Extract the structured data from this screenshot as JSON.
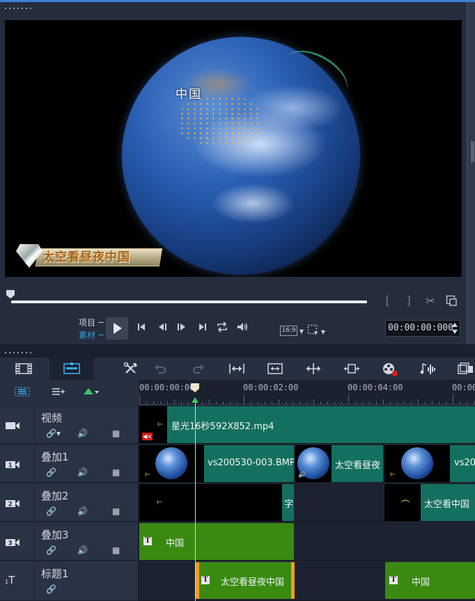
{
  "preview": {
    "overlay_text": "中国",
    "logo_text": "太空看昼夜中国"
  },
  "player": {
    "mode_project": "项目",
    "mode_clip": "素材",
    "aspect_ratio": "16:9",
    "timecode": "00:00:00:000",
    "mark_in": "[",
    "mark_out": "]"
  },
  "colors": {
    "accent": "#3b82d6",
    "video_clip": "#14705e",
    "title_clip": "#3a8a12",
    "selection": "#f39c22",
    "clip_active_text": "#2ba0e8"
  },
  "toolbar_icons": [
    "storyboard-view-icon",
    "timeline-view-icon",
    "tools-icon",
    "undo-icon",
    "redo-icon",
    "fit-to-window-icon",
    "zoom-to-fit-icon",
    "expand-icon",
    "track-height-icon",
    "record-capture-icon",
    "audio-mixer-icon",
    "multi-camera-icon"
  ],
  "timeline": {
    "ruler_labels": [
      "00:00:00:00",
      "00:00:02:00",
      "00:00:04:00",
      "00:00"
    ],
    "tracks": [
      {
        "id": "video",
        "icon_label": "",
        "name": "视频",
        "clips": [
          {
            "label": "星光16秒592X852.mp4"
          }
        ]
      },
      {
        "id": "overlay1",
        "icon_label": "1",
        "name": "叠加1",
        "clips": [
          {
            "label": "vs200530-003.BMP"
          },
          {
            "label": "太空看昼夜"
          },
          {
            "label": "vs20"
          }
        ]
      },
      {
        "id": "overlay2",
        "icon_label": "2",
        "name": "叠加2",
        "clips": [
          {
            "label": "字"
          },
          {
            "label": "太空看中国"
          }
        ]
      },
      {
        "id": "overlay3",
        "icon_label": "3",
        "name": "叠加3",
        "clips": [
          {
            "label": "中国"
          }
        ]
      },
      {
        "id": "title1",
        "icon_label": "1",
        "name": "标题1",
        "clips": [
          {
            "label": "太空看昼夜中国"
          },
          {
            "label": "中国"
          }
        ]
      }
    ]
  }
}
